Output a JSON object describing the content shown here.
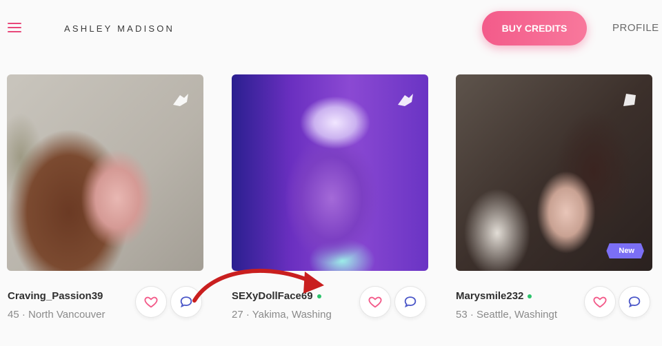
{
  "header": {
    "logo": "ASHLEY MADISON",
    "buy_credits": "BUY CREDITS",
    "profile": "PROFILE"
  },
  "profiles": [
    {
      "name": "Craving_Passion39",
      "location": "45 · North Vancouver",
      "online": false,
      "new": false
    },
    {
      "name": "SEXyDollFace69",
      "location": "27 · Yakima, Washing",
      "online": true,
      "new": false
    },
    {
      "name": "Marysmile232",
      "location": "53 · Seattle, Washingt",
      "online": true,
      "new": true,
      "new_label": "New"
    }
  ],
  "colors": {
    "accent": "#f35b8a",
    "online": "#2bc36b",
    "chat": "#4a56c8",
    "new_badge": "#7b6ff5"
  }
}
